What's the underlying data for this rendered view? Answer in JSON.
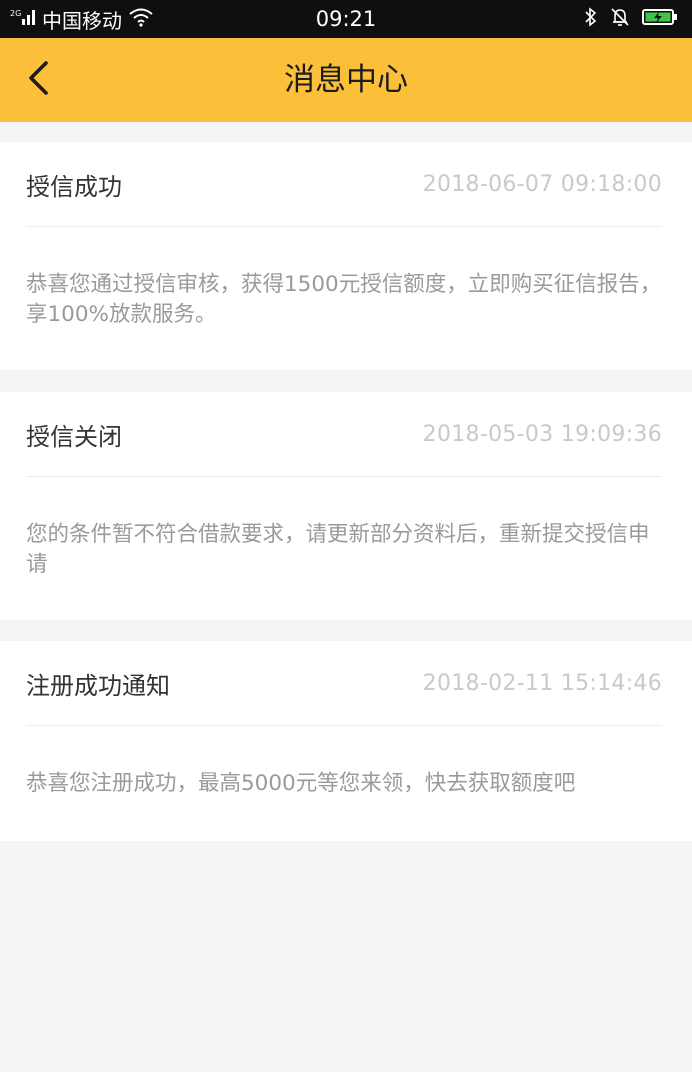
{
  "status_bar": {
    "carrier": "中国移动",
    "time": "09:21"
  },
  "nav": {
    "title": "消息中心"
  },
  "messages": [
    {
      "title": "授信成功",
      "time": "2018-06-07 09:18:00",
      "body": "恭喜您通过授信审核，获得1500元授信额度，立即购买征信报告，享100%放款服务。"
    },
    {
      "title": "授信关闭",
      "time": "2018-05-03 19:09:36",
      "body": "您的条件暂不符合借款要求，请更新部分资料后，重新提交授信申请"
    },
    {
      "title": "注册成功通知",
      "time": "2018-02-11 15:14:46",
      "body": "恭喜您注册成功，最高5000元等您来领，快去获取额度吧"
    }
  ]
}
